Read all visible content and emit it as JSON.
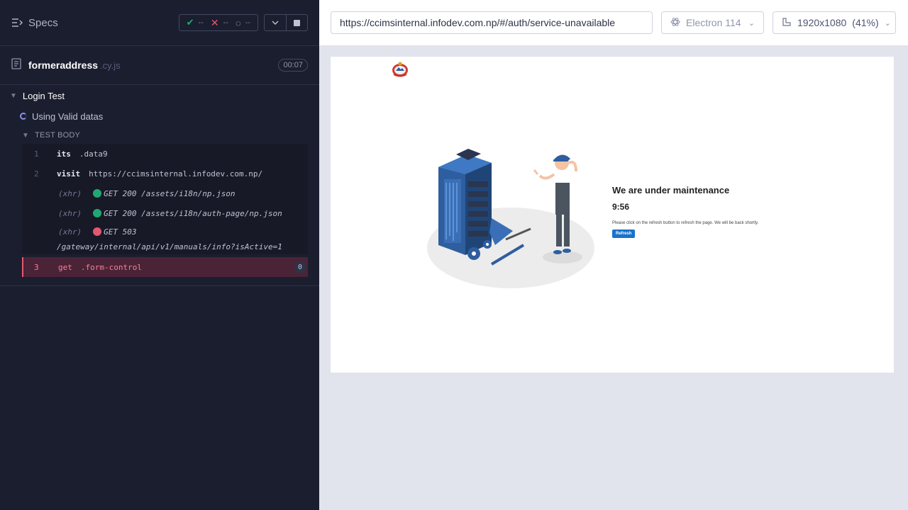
{
  "header": {
    "specs_label": "Specs",
    "passed": "--",
    "failed": "--",
    "pending": "--"
  },
  "spec": {
    "name": "formeraddress",
    "ext": ".cy.js",
    "duration": "00:07"
  },
  "suite": {
    "title": "Login Test",
    "test_title": "Using Valid datas",
    "body_label": "TEST BODY"
  },
  "commands": [
    {
      "num": "1",
      "name": "its",
      "message": ".data9"
    },
    {
      "num": "2",
      "name": "visit",
      "message": "https://ccimsinternal.infodev.com.np/"
    },
    {
      "num": "3",
      "name": "get",
      "message": ".form-control",
      "count": "0"
    }
  ],
  "xhr": [
    {
      "label": "(xhr)",
      "text": "GET 200 /assets/i18n/np.json",
      "status_color": "#1fa971"
    },
    {
      "label": "(xhr)",
      "text": "GET 200 /assets/i18n/auth-page/np.json",
      "status_color": "#1fa971"
    },
    {
      "label": "(xhr)",
      "text": "GET 503",
      "text2": "/gateway/internal/api/v1/manuals/info?isActive=1",
      "status_color": "#e45770"
    }
  ],
  "browser": {
    "url": "https://ccimsinternal.infodev.com.np/#/auth/service-unavailable",
    "name": "Electron 114",
    "viewport": "1920x1080",
    "scale": "(41%)"
  },
  "page": {
    "title": "We are under maintenance",
    "countdown": "9:56",
    "message": "Please click on the refresh button to refresh the page. We will be back shortly.",
    "refresh_label": "Refresh"
  }
}
